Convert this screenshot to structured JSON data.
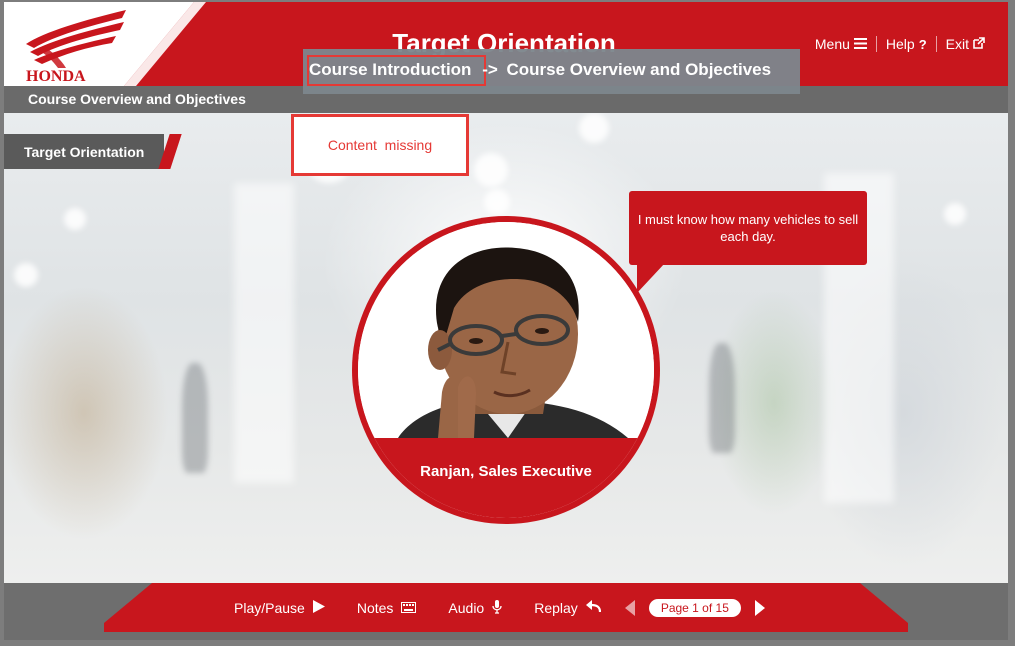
{
  "header": {
    "logo_text": "HONDA",
    "title": "Target Orientation",
    "nav": {
      "menu_label": "Menu",
      "help_label": "Help",
      "exit_label": "Exit"
    }
  },
  "subheader": {
    "title": "Course Overview and Objectives"
  },
  "section_tab": {
    "label": "Target Orientation"
  },
  "breadcrumb": {
    "first": "Course Introduction",
    "separator": "->",
    "second": "Course Overview and Objectives"
  },
  "content_missing": {
    "label": "Content  missing"
  },
  "speech_bubble": {
    "text": "I must know how many vehicles to sell each day."
  },
  "character": {
    "caption": "Ranjan, Sales Executive"
  },
  "footer": {
    "play_pause_label": "Play/Pause",
    "notes_label": "Notes",
    "audio_label": "Audio",
    "replay_label": "Replay",
    "page_indicator": "Page 1 of 15"
  },
  "colors": {
    "brand_red": "#c8161d",
    "dark_gray": "#6a6a6a",
    "highlight_red": "#e53935"
  },
  "icons": {
    "menu": "hamburger-icon",
    "help": "question-icon",
    "exit": "external-link-icon",
    "play": "play-icon",
    "notes": "keyboard-icon",
    "audio": "microphone-icon",
    "replay": "reply-arrow-icon",
    "prev": "arrow-left-icon",
    "next": "arrow-right-icon"
  }
}
